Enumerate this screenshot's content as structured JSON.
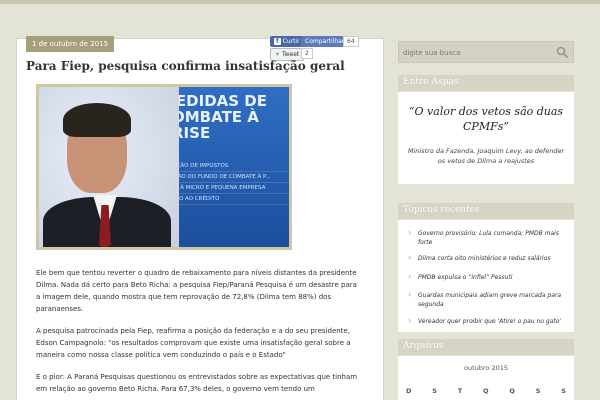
{
  "post": {
    "date": "1 de outubro de 2015",
    "title": "Para Fiep, pesquisa confirma insatisfação geral",
    "social": {
      "facebook_label": "Curtir",
      "share_label": "Compartilhar",
      "share_count": "64",
      "tweet_label": "Tweet",
      "tweet_count": "2"
    },
    "photo_text": {
      "headline": "MEDIDAS DE COMBATE À CRISE",
      "lines": [
        "REDUÇÃO DE IMPOSTOS",
        "CRIAÇÃO DO FUNDO DE COMBATE À P...",
        "APOIO À MICRO E PEQUENA EMPRESA",
        "ACESSO AO CRÉDITO"
      ]
    },
    "paragraphs": [
      "Ele bem que tentou reverter o quadro de rebaixamento para níveis distantes  da presidente Dilma. Nada dá certo para Beto Richa: a pesquisa Fiep/Paraná Pesquisa é um desastre para a imagem dele, quando mostra que tem reprovação de 72,8%  (Dilma tem 88%) dos paranaenses.",
      "A pesquisa patrocinada pela Fiep, reafirma a posição da  federação e  a do seu presidente, Edson Campagnolo:  \"os resultados comprovam que existe uma insatisfação geral sobre a maneira como nossa classe política vem conduzindo o país e o Estado\"",
      "E o pior: A Paraná Pesquisas questionou os entrevistados sobre as expectativas que tinham em relação ao governo Beto Richa. Para 67,3% deles, o governo vem tendo um"
    ]
  },
  "sidebar": {
    "search_placeholder": "digite sua busca",
    "entre_aspas": {
      "header": "Entre Aspas",
      "quote": "“O valor dos vetos são duas CPMFs”",
      "attribution": "Ministro da Fazenda, Joaquim Levy, ao defender os vetos de Dilma a reajustes"
    },
    "topicos": {
      "header": "Tópicos recentes",
      "items": [
        "Governo provisório: Lula comanda; PMDB mais forte",
        "Dilma corta oito ministérios e reduz salários",
        "PMDB expulsa o “infiel” Pessuti",
        "Guardas municipais adiam greve marcada para segunda",
        "Vereador quer proibir que 'Atire! o pau no gato'"
      ]
    },
    "arquivos": {
      "header": "Arquivos",
      "month": "outubro 2015",
      "days": [
        "D",
        "S",
        "T",
        "Q",
        "Q",
        "S",
        "S"
      ]
    }
  },
  "colors": {
    "background": "#e3e3d6",
    "badge": "#a79f7a",
    "sidebar_header": "#d6d4c5",
    "facebook": "#4a69a8"
  }
}
